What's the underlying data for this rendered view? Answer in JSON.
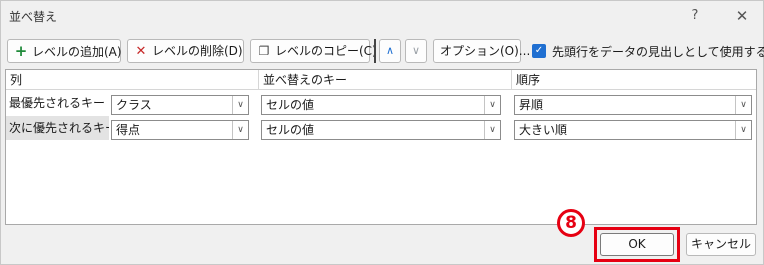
{
  "window": {
    "title": "並べ替え",
    "help": "?",
    "close": "✕"
  },
  "toolbar": {
    "add_level": "レベルの追加(A)",
    "delete_level": "レベルの削除(D)",
    "copy_level": "レベルのコピー(C)",
    "move_up": "∧",
    "move_down": "∨",
    "options": "オプション(O)...",
    "header_checkbox_checked": true,
    "header_checkbox_label": "先頭行をデータの見出しとして使用する(H)"
  },
  "grid": {
    "headers": {
      "column": "列",
      "sort_on": "並べ替えのキー",
      "order": "順序"
    },
    "rows": [
      {
        "label": "最優先されるキー",
        "column": "クラス",
        "sort_on": "セルの値",
        "order": "昇順",
        "selected": false
      },
      {
        "label": "次に優先されるキー",
        "column": "得点",
        "sort_on": "セルの値",
        "order": "大きい順",
        "selected": true
      }
    ]
  },
  "annotation": {
    "step": "8",
    "color": "#e60012"
  },
  "buttons": {
    "ok": "OK",
    "cancel": "キャンセル"
  },
  "colors": {
    "accent": "#1f6fd1",
    "highlight": "#e60012"
  }
}
